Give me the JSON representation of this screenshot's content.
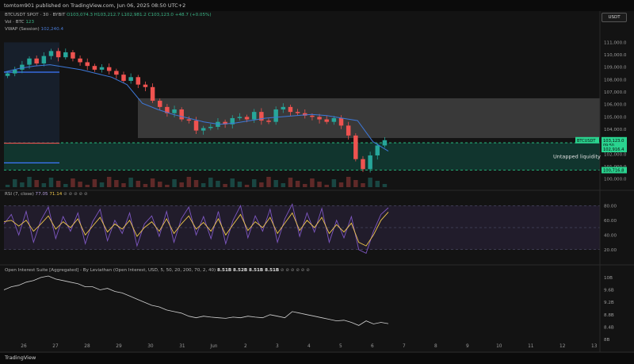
{
  "header": {
    "publisher": "tomtom901 published on TradingView.com, Jun 06, 2025 08:50 UTC+2"
  },
  "legend": {
    "symbol": "BTCUSDT SPOT · 30 · BYBIT",
    "ohlc": "O103,074.3 H103,212.7 L102,981.2 C103,123.0 +48.7 (+0.05%)",
    "vol_label": "Vol · BTC",
    "vol_value": "123",
    "vwap_label": "VWAP (Session)",
    "vwap_value": "102,240.4",
    "rsi_label": "RSI (7, close)",
    "rsi_v1": "77.05",
    "rsi_v2": "71.14",
    "rsi_icons": "⊘ ⊘ ⊘ ⊘ ⊘",
    "oi_label": "Open Interest Suite [Aggregated] - By Leviathan (Open Interest, USD, 5, 50, 20, 200, 70, 2, 40)",
    "oi_values": "8.51B  8.52B  8.51B  8.51B",
    "oi_icons": "⊘ ⊘ ⊘ ⊘ ⊘ ⊘"
  },
  "currency_button": "USDT",
  "annotation": "Untapped liquidity",
  "price_tag": {
    "symbol": "BTCUSDT",
    "price": "103,123.0",
    "countdown": "09:50",
    "level_upper": "102,916.4",
    "level_lower": "100,716.8"
  },
  "footer_logo": "TradingView",
  "colors": {
    "up": "#26a69a",
    "down": "#ef5350",
    "vwap": "#3d78d8",
    "rsi": "#f2c94c",
    "rsi_signal": "#7e57c2",
    "zone_grey": "#5a5a5a",
    "zone_green": "#123c34",
    "accent_green": "#2ad38f"
  },
  "chart_data": [
    {
      "type": "candlestick",
      "title": "BTCUSDT SPOT · 30 · BYBIT",
      "x_ticks": [
        "26",
        "27",
        "28",
        "29",
        "30",
        "31",
        "Jun",
        "2",
        "3",
        "4",
        "5",
        "6",
        "7",
        "8",
        "9",
        "10",
        "11",
        "12",
        "13"
      ],
      "y_ticks": [
        "111,000.0",
        "110,000.0",
        "109,000.0",
        "108,000.0",
        "107,000.0",
        "106,000.0",
        "105,000.0",
        "104,000.0",
        "103,000.0",
        "102,000.0",
        "101,000.0",
        "100,000.0"
      ],
      "ylim": [
        99600,
        111600
      ],
      "close_series": [
        108500,
        108800,
        109200,
        109700,
        109300,
        109900,
        110300,
        109800,
        110200,
        109700,
        109400,
        109100,
        108800,
        109000,
        108700,
        108400,
        107900,
        108200,
        107600,
        107400,
        106300,
        105800,
        105300,
        105600,
        104800,
        104700,
        103900,
        104100,
        104200,
        104600,
        104400,
        104900,
        105000,
        104800,
        105400,
        104700,
        104600,
        105600,
        105800,
        105400,
        105300,
        105100,
        105000,
        104800,
        104600,
        104900,
        104300,
        103500,
        101600,
        100800,
        101900,
        102700,
        103123
      ],
      "vwap_session": [
        108600,
        108900,
        109100,
        109200,
        109000,
        108800,
        108500,
        108200,
        107600,
        106100,
        105600,
        105200,
        104900,
        104600,
        104400,
        104500,
        104700,
        104900,
        105000,
        105100,
        105200,
        105100,
        104900,
        104700,
        103000,
        102240
      ],
      "zones": [
        {
          "label": "",
          "from": 103300,
          "to": 106500
        },
        {
          "label": "Untapped liquidity",
          "from": 100716.8,
          "to": 102916.4
        }
      ],
      "markers": {
        "blue_line": 108600
      }
    },
    {
      "type": "line",
      "title": "RSI (7, close)",
      "y_ticks": [
        "80.00",
        "60.00",
        "40.00",
        "20.00"
      ],
      "ylim": [
        10,
        90
      ],
      "bands": [
        20,
        50,
        80
      ],
      "series": [
        {
          "values": [
            55,
            68,
            40,
            72,
            30,
            60,
            78,
            35,
            65,
            45,
            70,
            28,
            58,
            75,
            32,
            60,
            42,
            70,
            25,
            55,
            66,
            38,
            72,
            30,
            62,
            78,
            40,
            65,
            35,
            72,
            28,
            60,
            80,
            36,
            66,
            45,
            75,
            30,
            62,
            82,
            38,
            70,
            44,
            76,
            30,
            60,
            36,
            65,
            20,
            15,
            45,
            68,
            77.05
          ]
        },
        {
          "values": [
            58,
            60,
            52,
            60,
            45,
            55,
            66,
            48,
            58,
            50,
            62,
            40,
            52,
            64,
            44,
            55,
            48,
            60,
            38,
            50,
            58,
            45,
            62,
            42,
            55,
            66,
            48,
            57,
            45,
            62,
            40,
            54,
            68,
            46,
            58,
            50,
            64,
            42,
            56,
            70,
            46,
            60,
            50,
            64,
            42,
            54,
            44,
            56,
            30,
            25,
            40,
            60,
            71.14
          ]
        }
      ]
    },
    {
      "type": "line",
      "title": "Open Interest Suite [Aggregated]",
      "y_ticks": [
        "10B",
        "9.6B",
        "9.2B",
        "8.8B",
        "8.4B",
        "8B"
      ],
      "ylim": [
        8.0,
        10.1
      ],
      "series": [
        {
          "values": [
            9.6,
            9.7,
            9.75,
            9.85,
            9.9,
            10.0,
            10.05,
            9.95,
            9.9,
            9.85,
            9.8,
            9.7,
            9.7,
            9.6,
            9.65,
            9.55,
            9.5,
            9.4,
            9.3,
            9.2,
            9.1,
            9.05,
            8.95,
            8.9,
            8.85,
            8.75,
            8.7,
            8.75,
            8.72,
            8.7,
            8.68,
            8.72,
            8.7,
            8.75,
            8.72,
            8.7,
            8.8,
            8.75,
            8.7,
            8.9,
            8.85,
            8.8,
            8.75,
            8.7,
            8.65,
            8.6,
            8.62,
            8.55,
            8.45,
            8.6,
            8.5,
            8.55,
            8.51
          ]
        }
      ]
    }
  ]
}
